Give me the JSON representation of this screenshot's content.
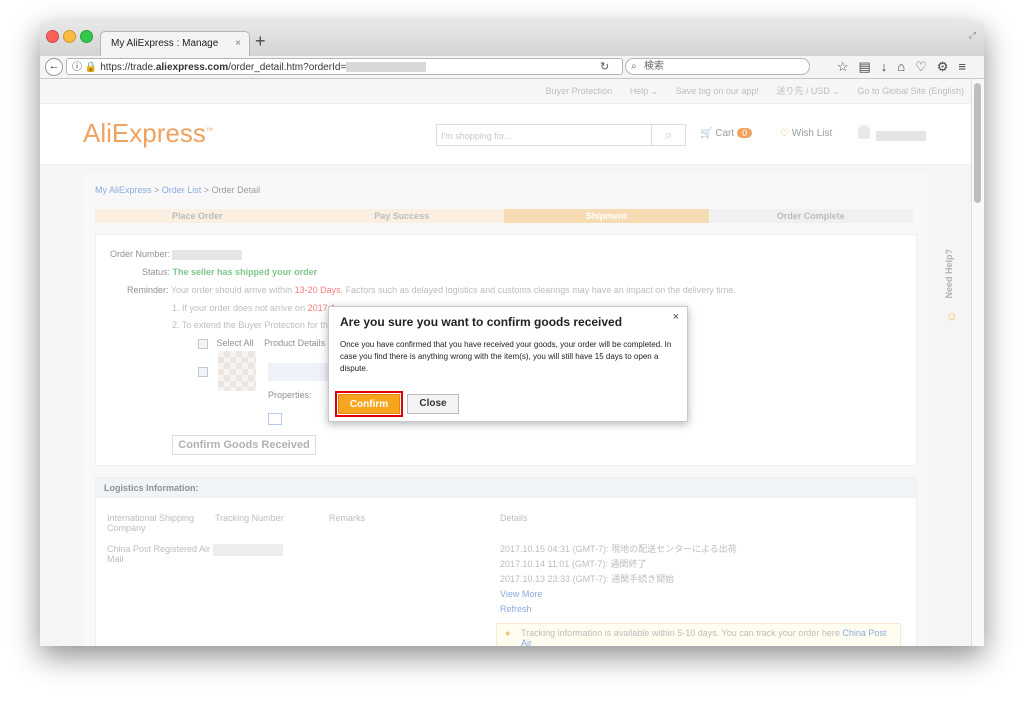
{
  "browser": {
    "tab_title": "My AliExpress : Manage Orders",
    "tab_close": "×",
    "new_tab": "+",
    "url_prefix": "https://trade.",
    "url_domain": "aliexpress.com",
    "url_path": "/order_detail.htm?orderId=",
    "search_placeholder": "検索",
    "toolbar_icons": [
      "star-icon",
      "reading-list-icon",
      "download-icon",
      "home-icon",
      "pocket-icon",
      "extension-icon",
      "menu-icon"
    ]
  },
  "topnav": {
    "items": [
      "Buyer Protection",
      "Help ⌄",
      "Save big on our app!",
      "送り先 / USD ⌄",
      "Go to Global Site (English)"
    ]
  },
  "header": {
    "logo": "AliExpress",
    "logo_tm": "™",
    "search_placeholder": "I'm shopping for...",
    "cart_label": "Cart",
    "cart_count": "0",
    "wishlist_label": "Wish List"
  },
  "breadcrumb": {
    "my_aliexpress": "My AliExpress",
    "sep1": " > ",
    "order_list": "Order List",
    "sep2": " > ",
    "current": "Order Detail"
  },
  "progress": [
    "Place Order",
    "Pay Success",
    "Shipment",
    "Order Complete"
  ],
  "order": {
    "number_label": "Order Number:",
    "status_label": "Status:",
    "status_value": "The seller has shipped your order",
    "reminder_label": "Reminder:",
    "reminder_text_1": "Your order should arrive within ",
    "reminder_days": "13-20 Days",
    "reminder_text_2": ", Factors such as delayed logistics and customs clearings may have an impact on the delivery time.",
    "note1_a": "1. If your order does not arrive on ",
    "note1_date": "2017-1",
    "note2": "2. To extend the Buyer Protection for this",
    "select_all": "Select All",
    "product_details": "Product Details",
    "properties": "Properties:",
    "confirm_goods": "Confirm Goods Received"
  },
  "logistics": {
    "header": "Logistics Information:",
    "col_company": "International Shipping Company",
    "col_tracking": "Tracking Number",
    "col_remarks": "Remarks",
    "col_details": "Details",
    "carrier": "China Post Registered Air Mail",
    "events": [
      "2017.10.15 04:31 (GMT-7): 現地の配送センターによる出荷",
      "2017.10.14 11:01 (GMT-7): 通関終了",
      "2017.10.13 23:33 (GMT-7): 通関手続き開始"
    ],
    "view_more": "View More",
    "refresh": "Refresh",
    "tip_text": "Tracking information is available within 5-10 days. You can track your order here ",
    "tip_link": "China Post Air"
  },
  "need_help": "Need Help?",
  "modal": {
    "title": "Are you sure you want to confirm goods received",
    "close": "×",
    "body": "Once you have confirmed that you have received your goods, your order will be completed. In case you find there is anything wrong with the item(s), you will still have 15 days to open a dispute.",
    "confirm": "Confirm",
    "cancel": "Close"
  }
}
